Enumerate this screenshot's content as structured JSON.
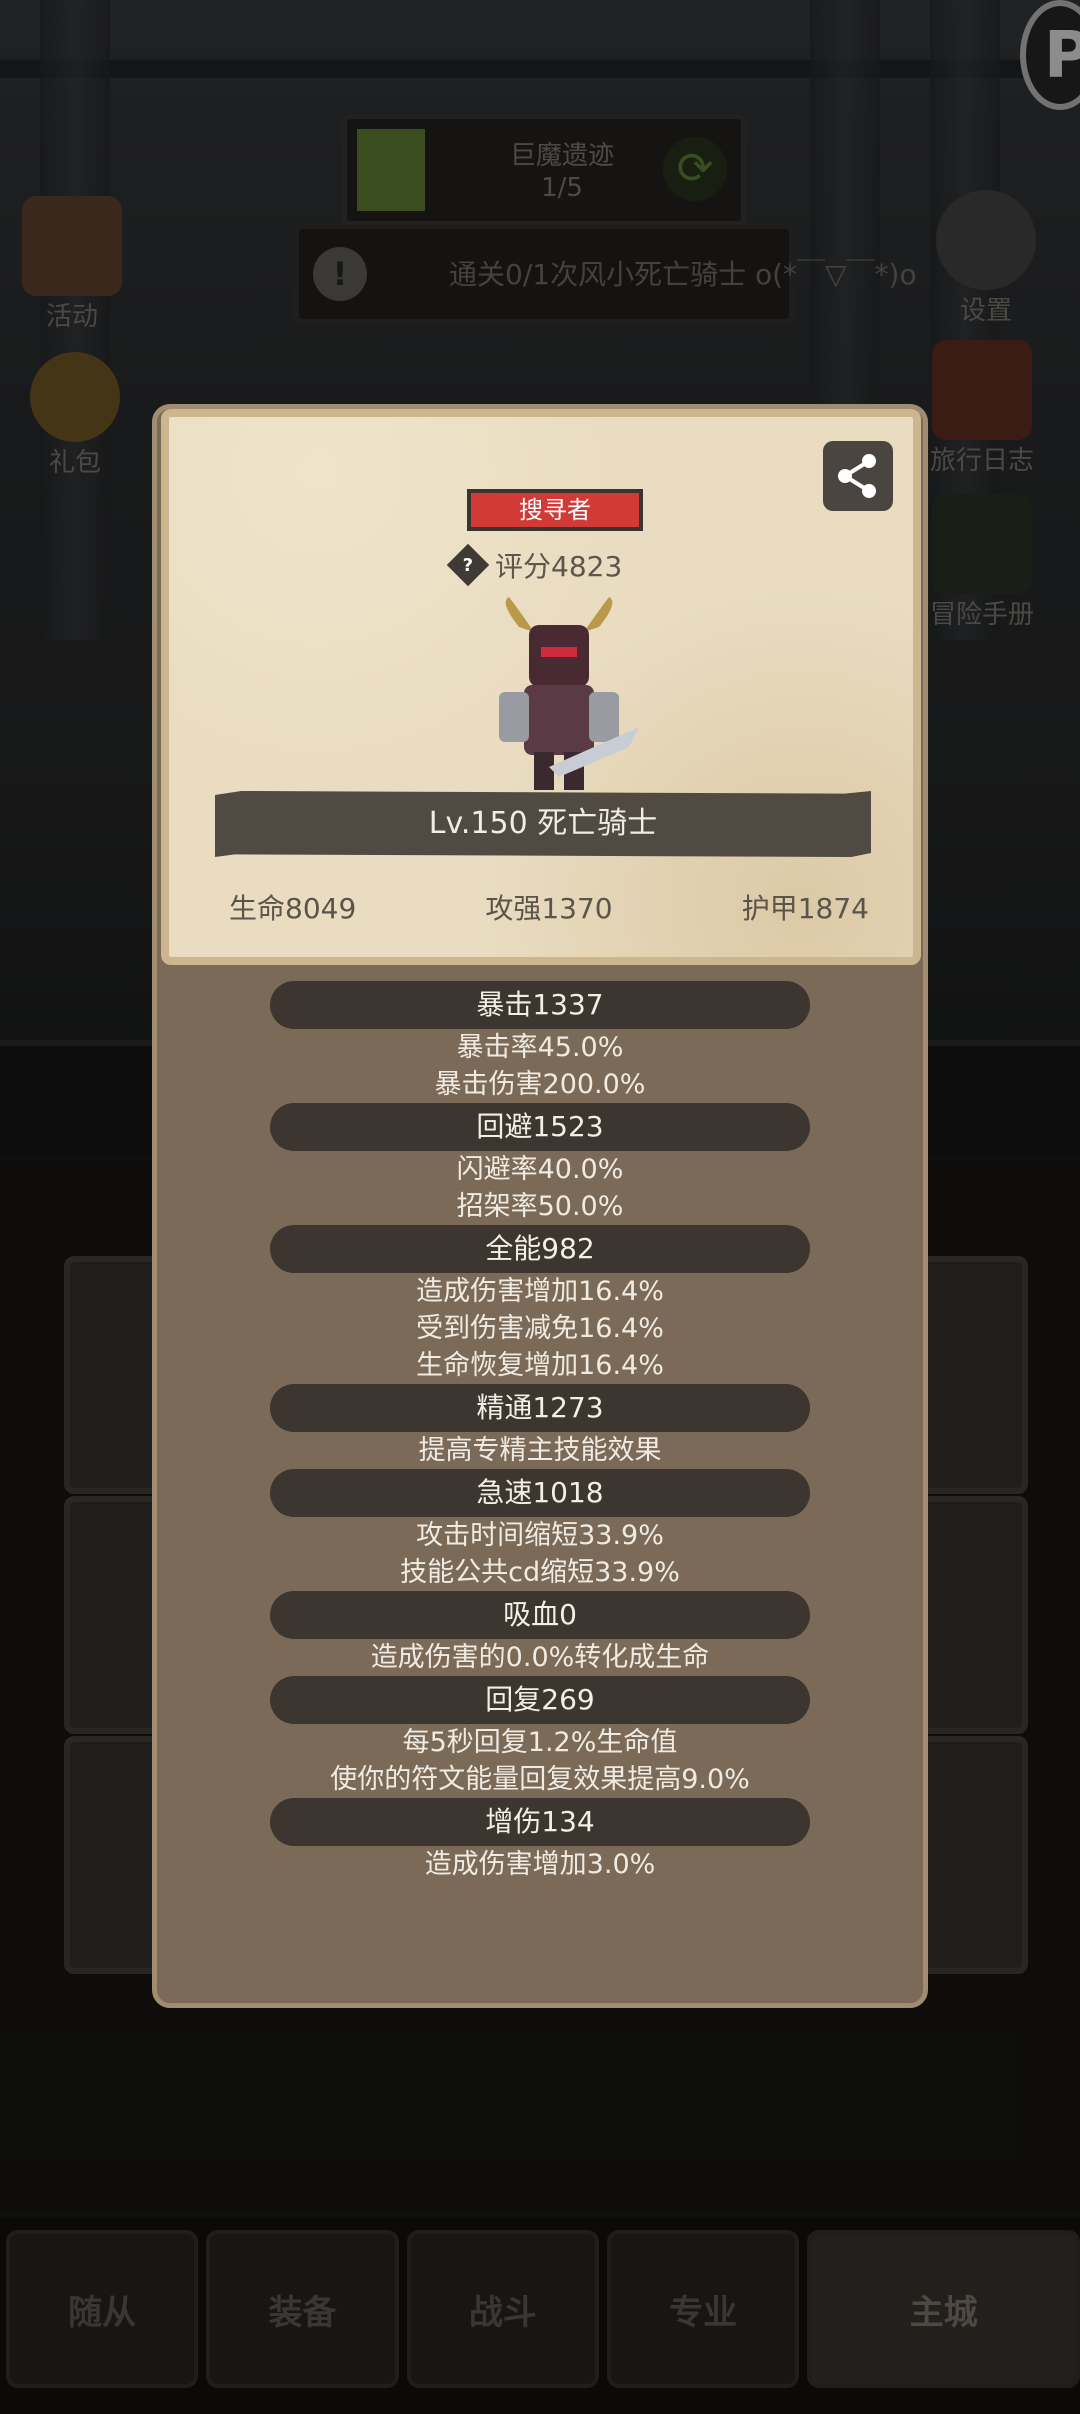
{
  "hud": {
    "stage_name": "巨魔遗迹",
    "stage_progress": "1/5",
    "quest_text": "通关0/1次风小死亡骑士 o(*￣▽￣*)o",
    "left_buttons": [
      {
        "label": "活动"
      },
      {
        "label": "礼包"
      }
    ],
    "right_buttons": [
      {
        "label": "设置"
      },
      {
        "label": "旅行日志"
      },
      {
        "label": "冒险手册"
      }
    ],
    "corner_letter": "P"
  },
  "bottom_nav": [
    "随从",
    "装备",
    "战斗",
    "专业",
    "主城"
  ],
  "modal": {
    "rank_badge": "搜寻者",
    "score": "评分4823",
    "hero_name": "Lv.150 死亡骑士",
    "base_stats": [
      "生命8049",
      "攻强1370",
      "护甲1874"
    ],
    "sections": [
      {
        "title": "暴击1337",
        "lines": [
          "暴击率45.0%",
          "暴击伤害200.0%"
        ]
      },
      {
        "title": "回避1523",
        "lines": [
          "闪避率40.0%",
          "招架率50.0%"
        ]
      },
      {
        "title": "全能982",
        "lines": [
          "造成伤害增加16.4%",
          "受到伤害减免16.4%",
          "生命恢复增加16.4%"
        ]
      },
      {
        "title": "精通1273",
        "lines": [
          "提高专精主技能效果"
        ]
      },
      {
        "title": "急速1018",
        "lines": [
          "攻击时间缩短33.9%",
          "技能公共cd缩短33.9%"
        ]
      },
      {
        "title": "吸血0",
        "lines": [
          "造成伤害的0.0%转化成生命"
        ]
      },
      {
        "title": "回复269",
        "lines": [
          "每5秒回复1.2%生命值",
          "使你的符文能量回复效果提高9.0%"
        ]
      },
      {
        "title": "增伤134",
        "lines": [
          "造成伤害增加3.0%"
        ]
      }
    ]
  }
}
